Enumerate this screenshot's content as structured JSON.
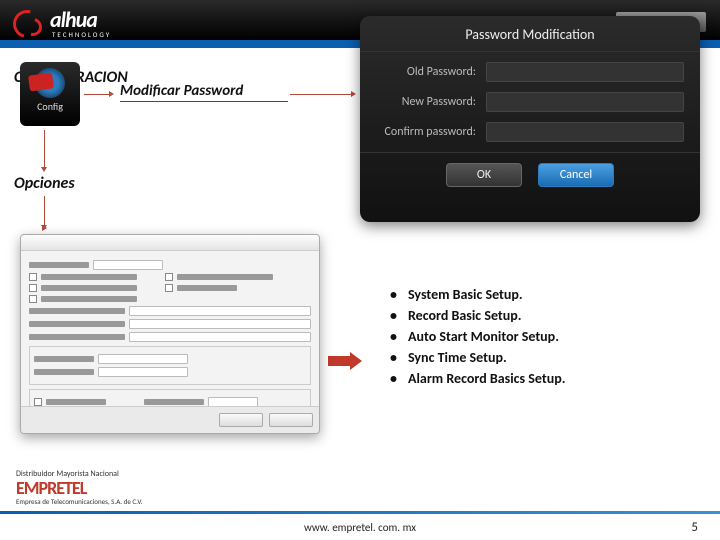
{
  "header": {
    "logo_text": "alhua",
    "logo_sub": "TECHNOLOGY"
  },
  "headings": {
    "configuracion": "CONFIGURACION",
    "modificar": "Modificar Password",
    "opciones": "Opciones"
  },
  "config_icon_label": "Config",
  "password_modal": {
    "title": "Password Modification",
    "old_label": "Old Password:",
    "new_label": "New Password:",
    "confirm_label": "Confirm password:",
    "ok": "OK",
    "cancel": "Cancel"
  },
  "bullets": [
    "System Basic Setup.",
    "Record Basic Setup.",
    "Auto Start Monitor Setup.",
    "Sync Time Setup.",
    "Alarm Record Basics Setup."
  ],
  "distributor": {
    "line1": "Distribuidor Mayorista Nacional",
    "brand": "EMPRETEL",
    "line2": "Empresa de Telecomunicaciones, S.A. de C.V."
  },
  "footer": {
    "url": "www. empretel. com. mx",
    "page": "5"
  }
}
